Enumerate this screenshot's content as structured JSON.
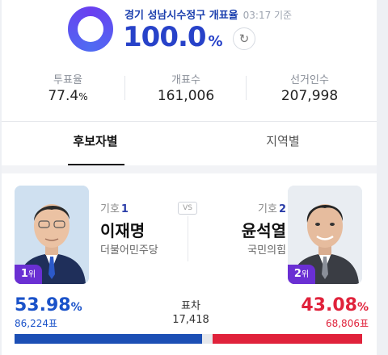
{
  "header": {
    "region": "경기 성남시수정구 개표율",
    "time": "03:17 기준",
    "rate_value": "100.0",
    "rate_unit": "%",
    "refresh_icon": "refresh-icon"
  },
  "stats": [
    {
      "label": "투표율",
      "value": "77.4",
      "unit": "%"
    },
    {
      "label": "개표수",
      "value": "161,006"
    },
    {
      "label": "선거인수",
      "value": "207,998"
    }
  ],
  "tabs": [
    {
      "label": "후보자별",
      "active": true
    },
    {
      "label": "지역별",
      "active": false
    }
  ],
  "vs_label": "VS",
  "candidates": [
    {
      "rank": "1",
      "rank_unit": "위",
      "number_prefix": "기호",
      "number": "1",
      "name": "이재명",
      "party": "더불어민주당",
      "percent": "53.98",
      "percent_unit": "%",
      "votes": "86,224표",
      "color": "#1a52c9",
      "share": 0.5398
    },
    {
      "rank": "2",
      "rank_unit": "위",
      "number_prefix": "기호",
      "number": "2",
      "name": "윤석열",
      "party": "국민의힘",
      "percent": "43.08",
      "percent_unit": "%",
      "votes": "68,806표",
      "color": "#e0223b",
      "share": 0.4308
    }
  ],
  "difference": {
    "label": "표차",
    "value": "17,418"
  }
}
